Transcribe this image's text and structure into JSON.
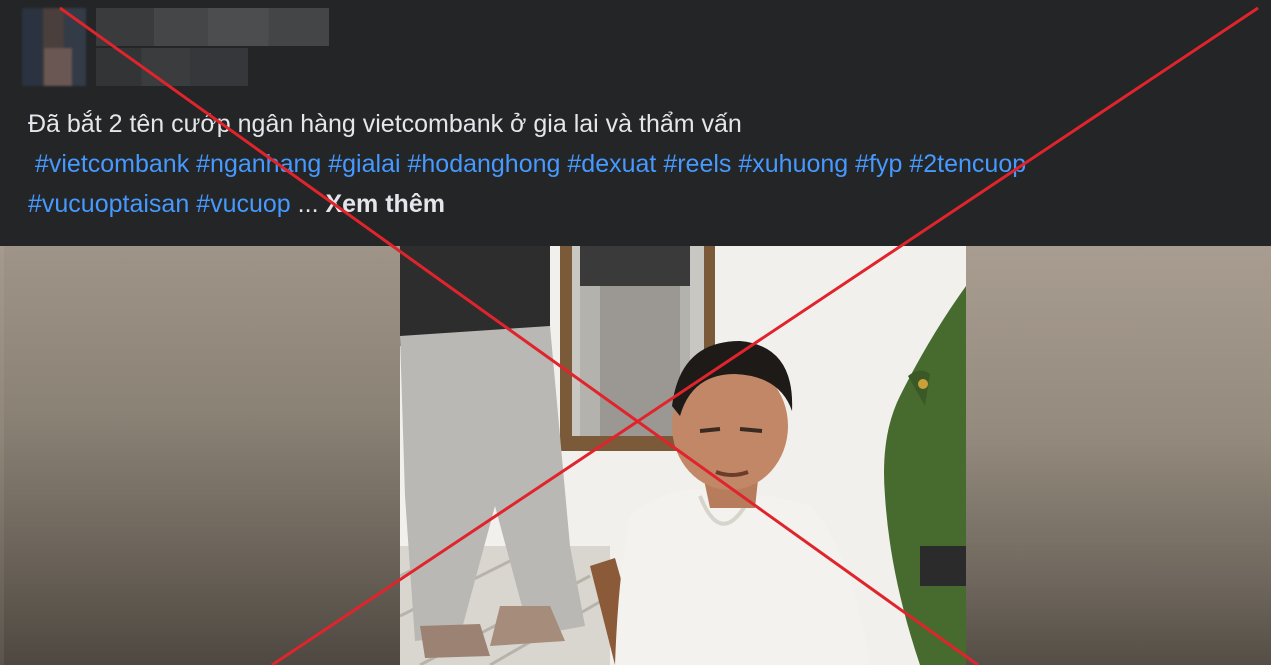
{
  "post": {
    "text": "Đã bắt 2 tên cướp ngân hàng vietcombank ở gia lai và thẩm vấn",
    "hashtags_line1": [
      "#vietcombank",
      "#nganhang",
      "#gialai",
      "#hodanghong",
      "#dexuat",
      "#reels",
      "#xuhuong",
      "#fyp",
      "#2tencuop"
    ],
    "hashtags_line2": [
      "#vucuoptaisan",
      "#vucuop"
    ],
    "ellipsis": "...",
    "see_more": "Xem thêm"
  },
  "overlay": {
    "cross_color": "#e0242c"
  }
}
